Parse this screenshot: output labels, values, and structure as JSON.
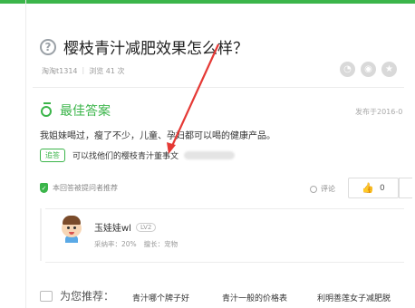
{
  "question": {
    "title": "樱枝青汁减肥效果怎么样？",
    "author": "淘淘t1314",
    "views": "浏览 41 次"
  },
  "best_answer": {
    "label": "最佳答案",
    "published": "发布于2016-0",
    "text": "我姐妹喝过，瘦了不少，儿童、孕妇都可以喝的健康产品。",
    "pursuit_tag": "追答",
    "pursuit_text": "可以找他们的樱枝青汁董事文",
    "recommended": "本回答被提问者推荐",
    "comment_label": "评论",
    "like_count": "0"
  },
  "answerer": {
    "name": "玉娃娃wl",
    "level": "LV2",
    "adopt_rate": "采纳率：20%",
    "specialty": "擅长：宠物"
  },
  "recommend": {
    "title": "为您推荐：",
    "links": [
      "青汁哪个牌子好",
      "青汁一般的价格表",
      "利明善莲女子减肥脱"
    ]
  },
  "colors": {
    "accent": "#3bb54a",
    "annotation": "#e53935"
  }
}
